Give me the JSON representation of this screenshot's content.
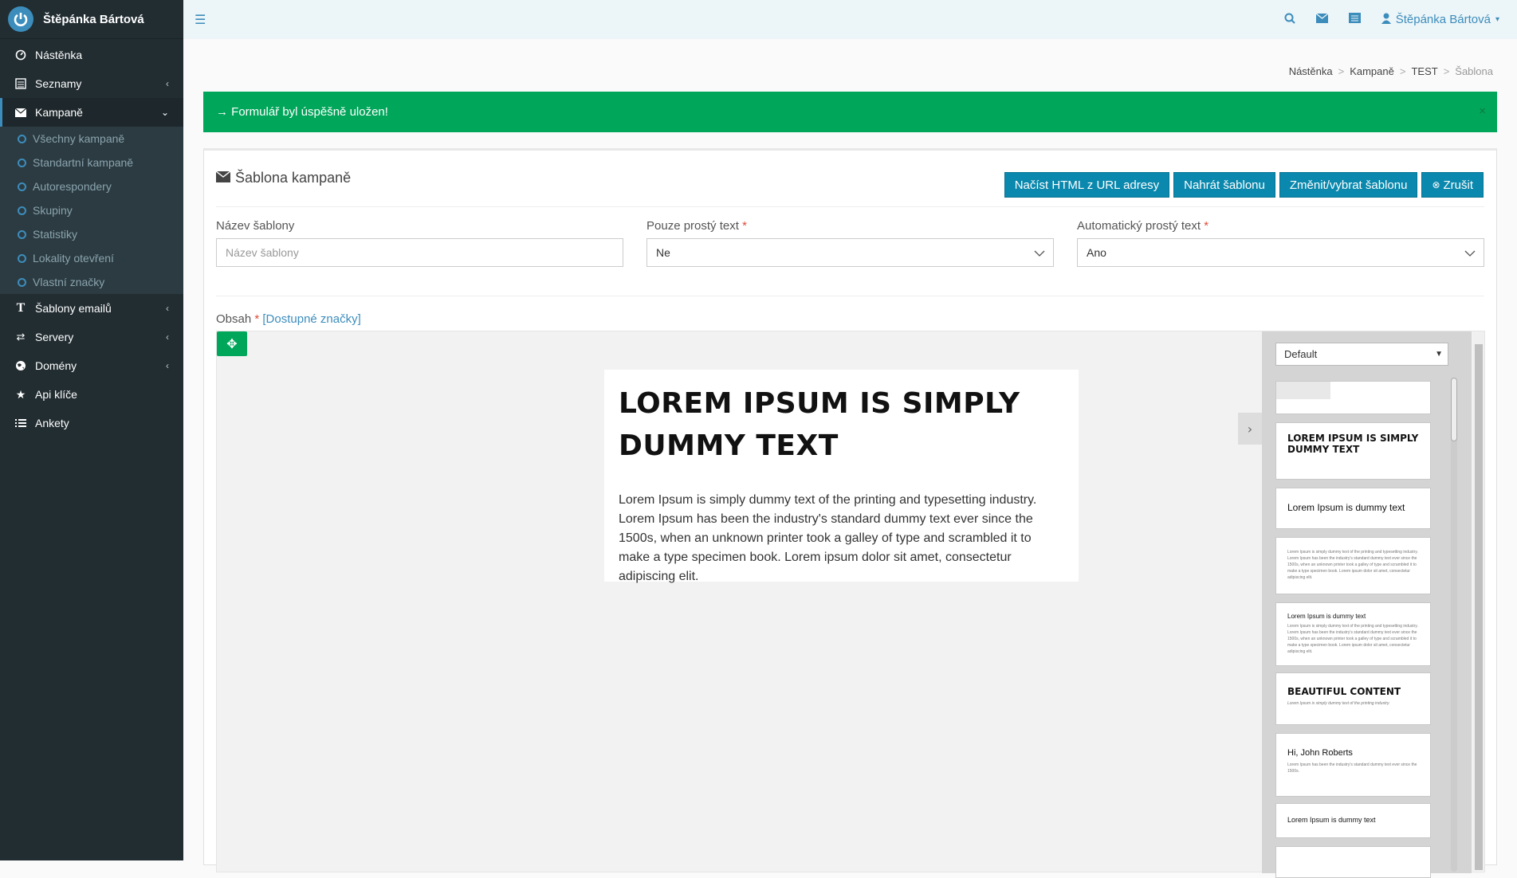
{
  "sidebar": {
    "user_name": "Štěpánka Bártová",
    "items": [
      {
        "label": "Nástěnka",
        "icon": "dashboard-icon"
      },
      {
        "label": "Seznamy",
        "icon": "list-icon"
      },
      {
        "label": "Kampaně",
        "icon": "envelope-icon"
      },
      {
        "label": "Šablony emailů",
        "icon": "text-icon"
      },
      {
        "label": "Servery",
        "icon": "exchange-icon"
      },
      {
        "label": "Domény",
        "icon": "globe-icon"
      },
      {
        "label": "Api klíče",
        "icon": "star-icon"
      },
      {
        "label": "Ankety",
        "icon": "list-icon"
      }
    ],
    "sub_items": [
      "Všechny kampaně",
      "Standartní kampaně",
      "Autorespondery",
      "Skupiny",
      "Statistiky",
      "Lokality otevření",
      "Vlastní značky"
    ]
  },
  "topbar": {
    "user_name": "Štěpánka Bártová"
  },
  "breadcrumb": [
    "Nástěnka",
    "Kampaně",
    "TEST",
    "Šablona"
  ],
  "alert": {
    "text": "→ Formulář byl úspěšně uložen!",
    "close": "×"
  },
  "box": {
    "title": "Šablona kampaně",
    "buttons": [
      "Načíst HTML z URL adresy",
      "Nahrát šablonu",
      "Změnit/vybrat šablonu",
      "Zrušit"
    ]
  },
  "form": {
    "name": {
      "label": "Název šablony",
      "placeholder": "Název šablony"
    },
    "plain": {
      "label": "Pouze prostý text",
      "required": "*",
      "value": "Ne"
    },
    "auto": {
      "label": "Automatický prostý text",
      "required": "*",
      "value": "Ano"
    },
    "content": {
      "label": "Obsah",
      "required": "*",
      "link": "[Dostupné značky]"
    }
  },
  "canvas": {
    "heading": "LOREM IPSUM IS SIMPLY DUMMY TEXT",
    "paragraph": "Lorem Ipsum is simply dummy text of the printing and typesetting industry. Lorem Ipsum has been the industry's standard dummy text ever since the 1500s, when an unknown printer took a galley of type and scrambled it to make a type specimen book. Lorem ipsum dolor sit amet, consectetur adipiscing elit."
  },
  "panel": {
    "select": "Default",
    "blocks": {
      "b1": "LOREM IPSUM IS SIMPLY DUMMY TEXT",
      "b2": "Lorem Ipsum is dummy text",
      "b3": "Lorem Ipsum is simply dummy text of the printing and typesetting industry. Lorem Ipsum has been the industry's standard dummy text ever since the 1500s, when an unknown printer took a galley of type and scrambled it to make a type specimen book. Lorem ipsum dolor sit amet, consectetur adipiscing elit.",
      "b4_title": "Lorem Ipsum is dummy text",
      "b4_text": "Lorem Ipsum is simply dummy text of the printing and typesetting industry. Lorem Ipsum has been the industry's standard dummy text ever since the 1500s, when an unknown printer took a galley of type and scrambled it to make a type specimen book. Lorem ipsum dolor sit amet, consectetur adipiscing elit.",
      "b5_title": "BEAUTIFUL CONTENT",
      "b5_text": "Lorem Ipsum is simply dummy text of the printing industry.",
      "b6_title": "Hi, John Roberts",
      "b6_text": "Lorem Ipsum has been the industry's standard dummy text ever since the 1500s.",
      "b7": "Lorem Ipsum is dummy text"
    }
  },
  "colors": {
    "sidebar": "#222d32",
    "accent": "#3c8dbc",
    "button": "#0b88ad",
    "success": "#00a65a"
  }
}
